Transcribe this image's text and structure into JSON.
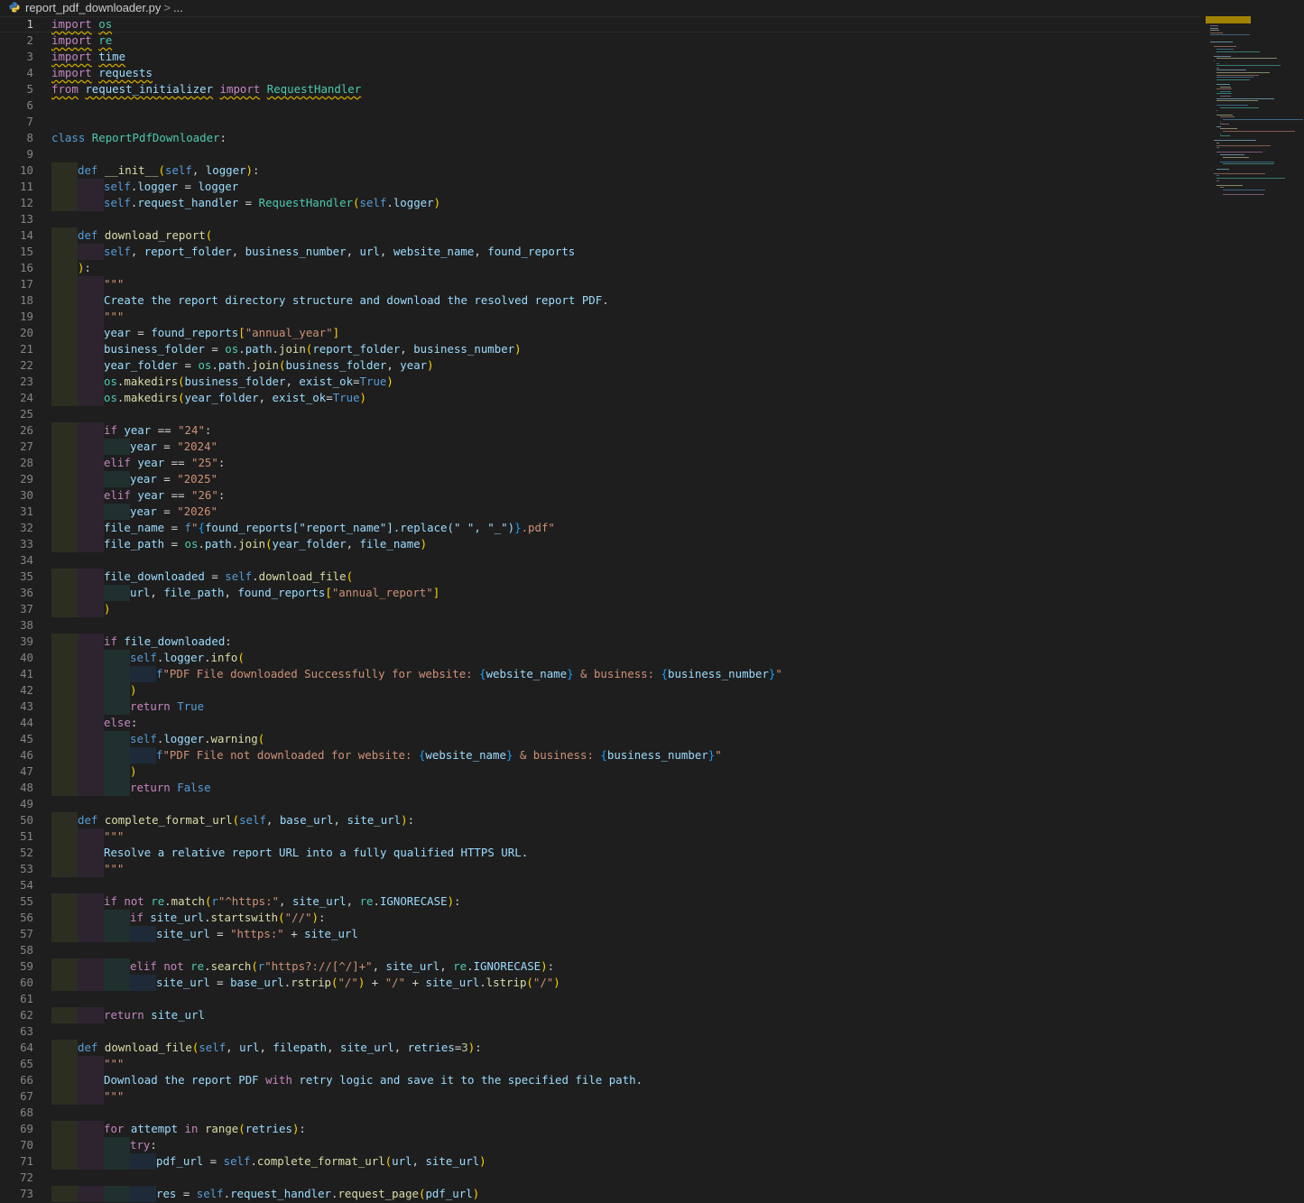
{
  "breadcrumb": {
    "file": "report_pdf_downloader.py",
    "separator": ">",
    "more": "..."
  },
  "editor": {
    "active_line": 1,
    "lines": [
      "import os",
      "import re",
      "import time",
      "import requests",
      "from request_initializer import RequestHandler",
      "",
      "",
      "class ReportPdfDownloader:",
      "",
      "    def __init__(self, logger):",
      "        self.logger = logger",
      "        self.request_handler = RequestHandler(self.logger)",
      "",
      "    def download_report(",
      "        self, report_folder, business_number, url, website_name, found_reports",
      "    ):",
      "        \"\"\"",
      "        Create the report directory structure and download the resolved report PDF.",
      "        \"\"\"",
      "        year = found_reports[\"annual_year\"]",
      "        business_folder = os.path.join(report_folder, business_number)",
      "        year_folder = os.path.join(business_folder, year)",
      "        os.makedirs(business_folder, exist_ok=True)",
      "        os.makedirs(year_folder, exist_ok=True)",
      "",
      "        if year == \"24\":",
      "            year = \"2024\"",
      "        elif year == \"25\":",
      "            year = \"2025\"",
      "        elif year == \"26\":",
      "            year = \"2026\"",
      "        file_name = f\"{found_reports[\"report_name\"].replace(\" \", \"_\")}.pdf\"",
      "        file_path = os.path.join(year_folder, file_name)",
      "",
      "        file_downloaded = self.download_file(",
      "            url, file_path, found_reports[\"annual_report\"]",
      "        )",
      "",
      "        if file_downloaded:",
      "            self.logger.info(",
      "                f\"PDF File downloaded Successfully for website: {website_name} & business: {business_number}\"",
      "            )",
      "            return True",
      "        else:",
      "            self.logger.warning(",
      "                f\"PDF File not downloaded for website: {website_name} & business: {business_number}\"",
      "            )",
      "            return False",
      "",
      "    def complete_format_url(self, base_url, site_url):",
      "        \"\"\"",
      "        Resolve a relative report URL into a fully qualified HTTPS URL.",
      "        \"\"\"",
      "",
      "        if not re.match(r\"^https:\", site_url, re.IGNORECASE):",
      "            if site_url.startswith(\"//\"):",
      "                site_url = \"https:\" + site_url",
      "",
      "            elif not re.search(r\"https?://[^/]+\", site_url, re.IGNORECASE):",
      "                site_url = base_url.rstrip(\"/\") + \"/\" + site_url.lstrip(\"/\")",
      "",
      "        return site_url",
      "",
      "    def download_file(self, url, filepath, site_url, retries=3):",
      "        \"\"\"",
      "        Download the report PDF with retry logic and save it to the specified file path.",
      "        \"\"\"",
      "",
      "        for attempt in range(retries):",
      "            try:",
      "                pdf_url = self.complete_format_url(url, site_url)",
      "",
      "                res = self.request_handler.request_page(pdf_url)"
    ]
  },
  "colors": {
    "background": "#1e1e1e",
    "keyword_import": "#c586c0",
    "keyword_def": "#569cd6",
    "class_name": "#4ec9b0",
    "function": "#dcdcaa",
    "variable": "#9cdcfe",
    "string": "#ce9178",
    "number": "#b5cea8",
    "bracket_1": "#ffd700",
    "bracket_2": "#da70d6",
    "bracket_3": "#179fff",
    "warning_squiggle": "#cca700",
    "line_number": "#858585"
  },
  "icons": {
    "file_icon": "python-file-icon",
    "minimap": "minimap"
  }
}
